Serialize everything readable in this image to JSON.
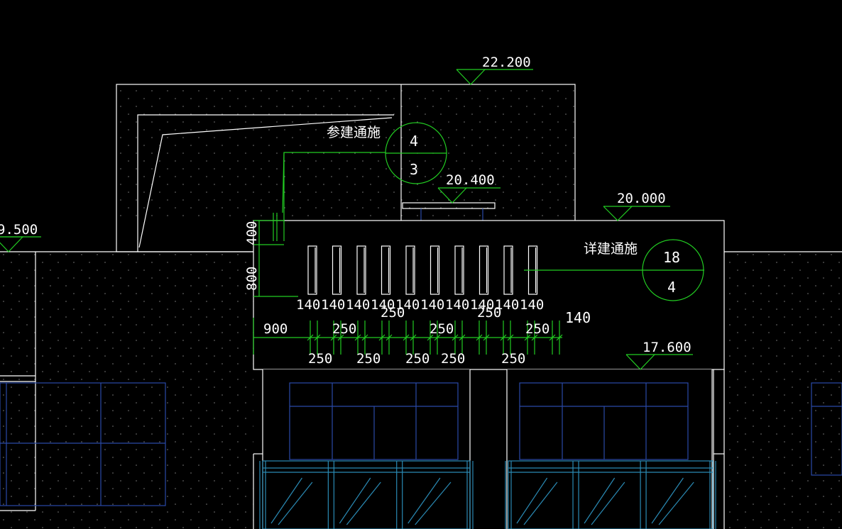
{
  "elevations": {
    "e1": "22.200",
    "e2": "20.400",
    "e3": "20.000",
    "e4": "17.600",
    "e5": "9.500"
  },
  "callout_a": {
    "note": "参建通施",
    "num": "4",
    "sheet": "3"
  },
  "callout_b": {
    "note": "详建通施",
    "num": "18",
    "sheet": "4"
  },
  "vertical_dims": {
    "top": "400",
    "bottom": "800"
  },
  "bar_width_labels": [
    "140",
    "140",
    "140",
    "140",
    "140",
    "140",
    "140",
    "140",
    "140",
    "140"
  ],
  "gap_labels_upper": [
    "250",
    "250"
  ],
  "right_dim": "140",
  "bottom_dims_row1": [
    "900",
    "250",
    "250",
    "250"
  ],
  "bottom_dims_row2": [
    "250",
    "250",
    "250",
    "250",
    "250"
  ],
  "colors": {
    "background": "#000000",
    "line": "#ffffff",
    "dimension": "#22cc22",
    "window": "#2a4aa8",
    "railing": "#2a8ab4"
  }
}
